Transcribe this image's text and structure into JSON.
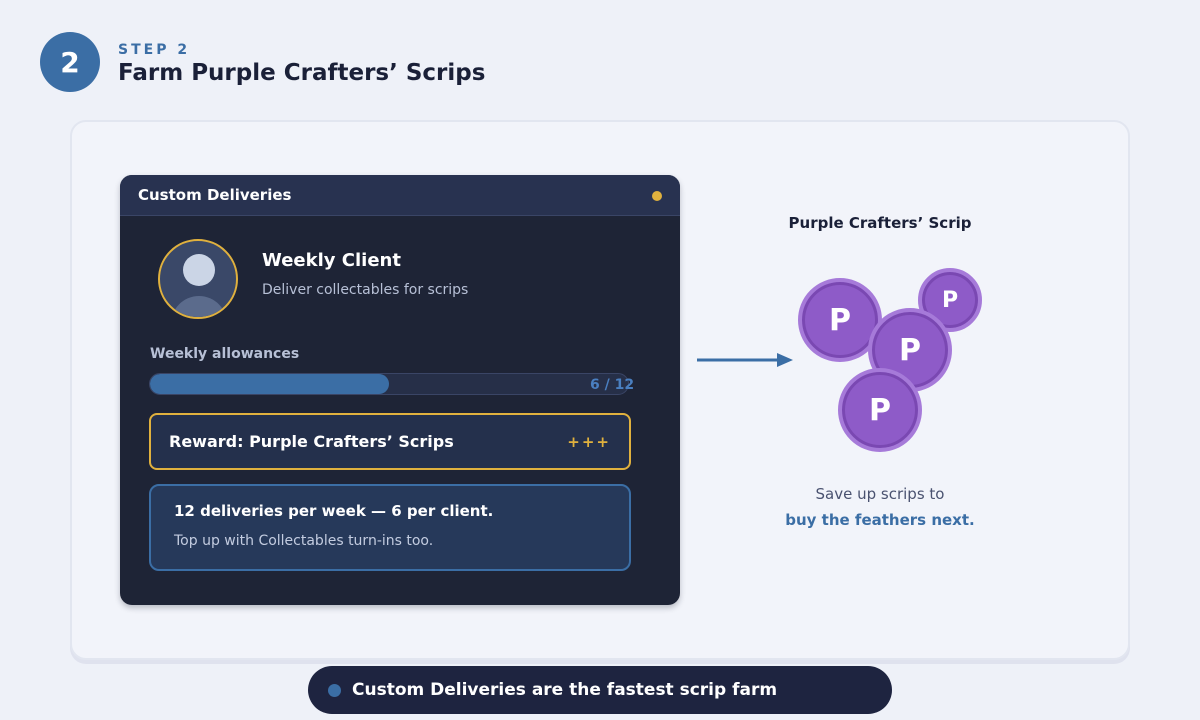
{
  "step": {
    "number": "2",
    "label": "STEP 2",
    "title": "Farm Purple Crafters’ Scrips"
  },
  "panel": {
    "title": "Custom Deliveries",
    "client": {
      "name": "Weekly Client",
      "description": "Deliver collectables for scrips"
    },
    "allowance": {
      "label": "Weekly allowances",
      "text": "6 / 12",
      "current": 6,
      "max": 12
    },
    "reward": {
      "text": "Reward: Purple Crafters’ Scrips",
      "plus": "+++"
    },
    "info": {
      "title": "12 deliveries per week — 6 per client.",
      "subtitle": "Top up with Collectables turn-ins too."
    }
  },
  "currency": {
    "title": "Purple Crafters’ Scrip",
    "coin_letter": "P",
    "note": "Save up scrips to",
    "cta": "buy the feathers next."
  },
  "footer": {
    "text": "Custom Deliveries are the fastest scrip farm"
  },
  "colors": {
    "accent": "#3b6ea5",
    "gold": "#e0b13e",
    "scrip_purple": "#8e5bc8",
    "panel_dark": "#1e2436"
  }
}
